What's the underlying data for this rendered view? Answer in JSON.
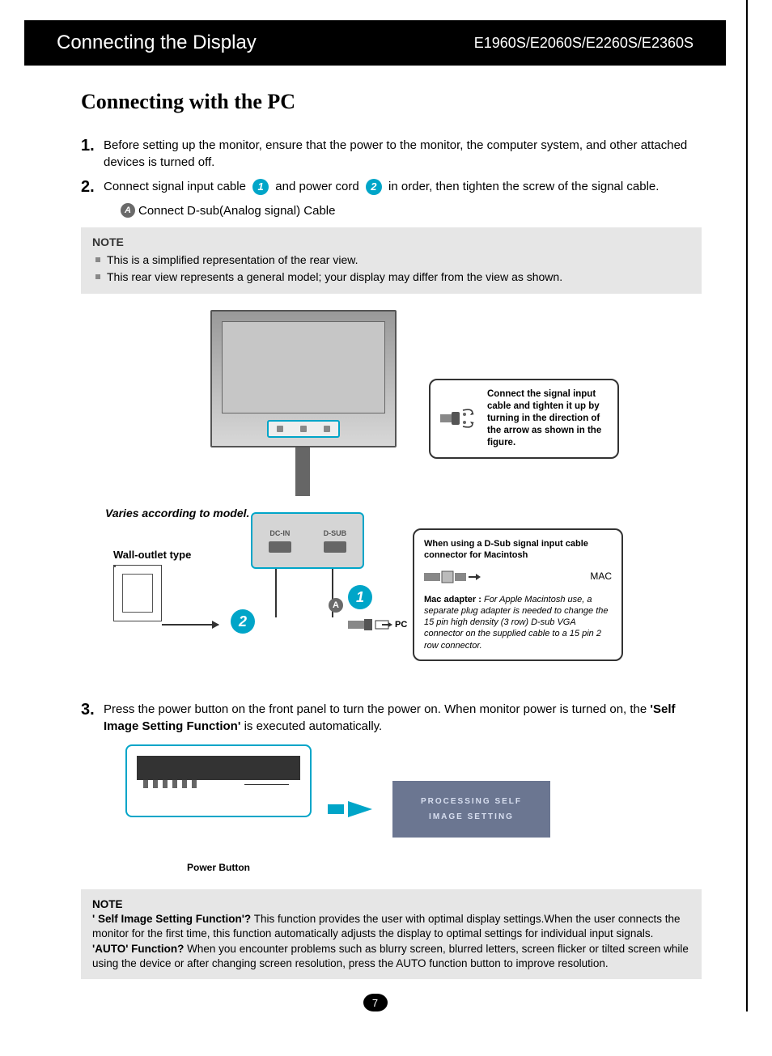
{
  "header": {
    "left": "Connecting the Display",
    "right": "E1960S/E2060S/E2260S/E2360S"
  },
  "section_title": "Connecting with the PC",
  "steps": {
    "s1": {
      "num": "1.",
      "text": "Before setting up the monitor, ensure that the power to the monitor, the computer system, and other attached devices is turned off."
    },
    "s2": {
      "num": "2.",
      "text_a": "Connect signal input cable ",
      "text_b": " and power cord ",
      "text_c": " in order, then tighten the screw of the signal cable.",
      "badge1": "1",
      "badge2": "2"
    },
    "sub_a": {
      "badge": "A",
      "text": "Connect D-sub(Analog signal) Cable"
    },
    "s3": {
      "num": "3.",
      "text_a": "Press the power button on the front panel to turn the power on. When monitor power is turned on, the ",
      "bold": "'Self Image Setting Function'",
      "text_b": " is executed automatically."
    }
  },
  "note1": {
    "title": "NOTE",
    "line1": "This is a simplified representation of the rear view.",
    "line2": "This rear view represents a general model; your display may differ from the view as shown."
  },
  "diagram": {
    "varies": "Varies according to model.",
    "wall": "Wall-outlet type",
    "port1": "DC-IN",
    "port2": "D-SUB",
    "pc": "PC",
    "circ1": "1",
    "circ2": "2",
    "circA": "A"
  },
  "callout1": {
    "text": "Connect the signal input cable and tighten it up by turning in the direction of the arrow as shown in the figure."
  },
  "callout2": {
    "heading": "When using a D-Sub signal input cable connector for Macintosh",
    "mac": "MAC",
    "adapter_label": "Mac adapter : ",
    "adapter_desc": "For Apple Macintosh use, a  separate plug adapter is needed to change the 15 pin high density (3 row) D-sub VGA connector on the supplied cable to a 15 pin  2 row connector."
  },
  "power_button": "Power Button",
  "osd": {
    "l1": "PROCESSING SELF",
    "l2": "IMAGE SETTING"
  },
  "note2": {
    "title": "NOTE",
    "q1": "' Self Image Setting Function'?",
    "a1": " This function provides the user with optimal display settings.When the user connects the monitor for the first time, this function automatically adjusts the display to optimal settings for individual input signals.",
    "q2": "'AUTO' Function?",
    "a2": " When you encounter problems such as blurry screen, blurred letters, screen flicker or tilted screen while using the device or after changing screen resolution, press the AUTO function button to improve resolution."
  },
  "page_number": "7"
}
